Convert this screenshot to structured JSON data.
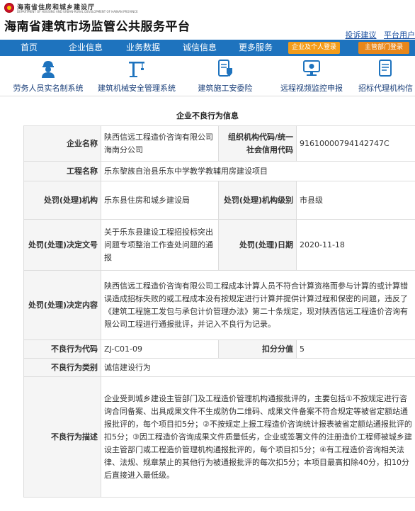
{
  "header": {
    "dept_name": "海南省住房和城乡建设厅",
    "dept_sub": "DEPARTMENT OF HOUSING AND URBAN-RURAL DEVELOPMENT OF HAINAN PROVINCE",
    "site_title": "海南省建筑市场监管公共服务平台",
    "links": [
      "投诉建议",
      "平台用户"
    ]
  },
  "nav": {
    "items": [
      "首页",
      "企业信息",
      "业务数据",
      "诚信信息",
      "更多服务"
    ],
    "btn_enterprise": "企业及个人登录",
    "btn_admin": "主管部门登录"
  },
  "systems": [
    {
      "label": "劳务人员实名制系统",
      "icon": "worker-icon"
    },
    {
      "label": "建筑机械安全管理系统",
      "icon": "crane-icon"
    },
    {
      "label": "建筑施工安委险",
      "icon": "insurance-icon"
    },
    {
      "label": "远程视频监控申报",
      "icon": "video-monitor-icon"
    },
    {
      "label": "招标代理机构信",
      "icon": "document-icon"
    }
  ],
  "card": {
    "title": "企业不良行为信息",
    "company_name_label": "企业名称",
    "company_name": "陕西信远工程造价咨询有限公司海南分公司",
    "org_code_label": "组织机构代码/统一社会信用代码",
    "org_code": "91610000794142747C",
    "project_label": "工程名称",
    "project": "乐东黎族自治县乐东中学教学教辅用房建设项目",
    "penalty_org_label": "处罚(处理)机构",
    "penalty_org": "乐东县住房和城乡建设局",
    "penalty_level_label": "处罚(处理)机构级别",
    "penalty_level": "市县级",
    "decision_no_label": "处罚(处理)决定文号",
    "decision_no": "关于乐东县建设工程招投标突出问题专项整治工作查处问题的通报",
    "decision_date_label": "处罚(处理)日期",
    "decision_date": "2020-11-18",
    "decision_content_label": "处罚(处理)决定内容",
    "decision_content": "陕西信远工程造价咨询有限公司工程成本计算人员不符合计算资格而参与计算的或计算错误造成招标失败的或工程成本没有按规定进行计算并提供计算过程和保密的问题，违反了《建筑工程施工发包与承包计价管理办法》第二十条规定，现对陕西信远工程造价咨询有限公司工程进行通报批评，并记入不良行为记录。",
    "behavior_code_label": "不良行为代码",
    "behavior_code": "ZJ-C01-09",
    "deduct_label": "扣分分值",
    "deduct": "5",
    "category_label": "不良行为类别",
    "category": "诚信建设行为",
    "desc_label": "不良行为描述",
    "desc": "企业受到城乡建设主管部门及工程造价管理机构通报批评的，主要包括①不按规定进行咨询合同备案、出具成果文件不生成防伪二维码、成果文件备案不符合规定等被省定额站通报批评的，每个项目扣5分；②不按规定上报工程造价咨询统计报表被省定额站通报批评的扣5分；③因工程造价咨询成果文件质量低劣，企业或签署文件的注册造价工程师被城乡建设主管部门或工程造价管理机构通报批评的，每个项目扣5分；④有工程造价咨询相关法律、法规、规章禁止的其他行为被通报批评的每次扣5分；本项目最高扣除40分，扣10分后直接进入最低级。"
  },
  "colors": {
    "nav_bg": "#1e73be",
    "btn_orange": "#f39c1a",
    "label_bg": "#f5f5f5"
  }
}
